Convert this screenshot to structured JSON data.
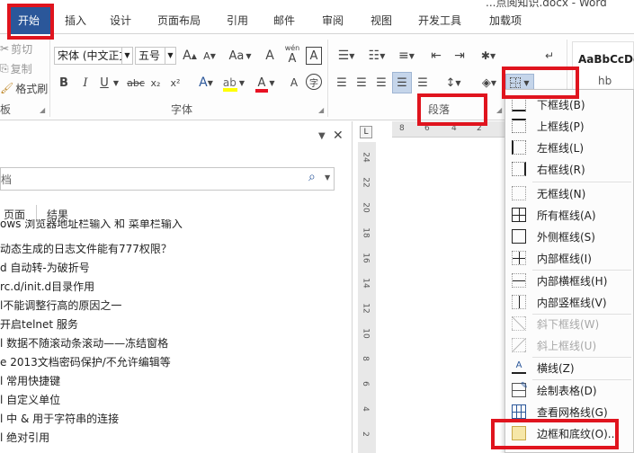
{
  "title": "...点阅知识.docx - Word",
  "tabs": [
    "开始",
    "插入",
    "设计",
    "页面布局",
    "引用",
    "邮件",
    "审阅",
    "视图",
    "开发工具",
    "加载项"
  ],
  "clipboard": {
    "cut": "剪切",
    "copy": "复制",
    "format_painter": "格式刷",
    "group_label": "板"
  },
  "font": {
    "name": "宋体 (中文正文)",
    "size": "五号",
    "grow": "A",
    "shrink": "A",
    "case": "Aa",
    "clear": "A",
    "pinyin_top": "wén",
    "pinyin_char": "A",
    "border_char": "A",
    "bold": "B",
    "italic": "I",
    "underline": "U",
    "strike": "abc",
    "sub": "x₂",
    "sup": "x²",
    "group_label": "字体"
  },
  "paragraph": {
    "group_label": "段落"
  },
  "styles": {
    "sample": "AaBbCcDd",
    "sample_label": "hb"
  },
  "nav": {
    "search_placeholder": "档",
    "tabs": [
      "页面",
      "结果"
    ],
    "items": [
      "ows 浏览器地址栏输入 和 菜单栏输入",
      "动态生成的日志文件能有777权限？",
      "d 自动转-为破折号",
      "rc.d/init.d目录作用",
      "l不能调整行高的原因之一",
      "开启telnet 服务",
      "l 数据不随滚动条滚动——冻结窗格",
      "e 2013文档密码保护/不允许编辑等",
      "l 常用快捷键",
      "l 自定义单位",
      "l 中 & 用于字符串的连接",
      "l 绝对引用"
    ]
  },
  "ruler": {
    "h_ticks": [
      "8",
      "6",
      "4",
      "2"
    ],
    "v_ticks": [
      "24",
      "22",
      "20",
      "18",
      "16",
      "14",
      "12",
      "10",
      "8",
      "6",
      "4",
      "2"
    ]
  },
  "border_menu": {
    "items": [
      {
        "label": "下框线(B)",
        "enabled": true
      },
      {
        "label": "上框线(P)",
        "enabled": true
      },
      {
        "label": "左框线(L)",
        "enabled": true
      },
      {
        "label": "右框线(R)",
        "enabled": true
      },
      {
        "label": "无框线(N)",
        "enabled": true
      },
      {
        "label": "所有框线(A)",
        "enabled": true
      },
      {
        "label": "外侧框线(S)",
        "enabled": true
      },
      {
        "label": "内部框线(I)",
        "enabled": true
      },
      {
        "label": "内部横框线(H)",
        "enabled": true
      },
      {
        "label": "内部竖框线(V)",
        "enabled": true
      },
      {
        "label": "斜下框线(W)",
        "enabled": false
      },
      {
        "label": "斜上框线(U)",
        "enabled": false
      },
      {
        "label": "横线(Z)",
        "enabled": true
      },
      {
        "label": "绘制表格(D)",
        "enabled": true
      },
      {
        "label": "查看网格线(G)",
        "enabled": true
      },
      {
        "label": "边框和底纹(O)...",
        "enabled": true
      }
    ]
  },
  "colors": {
    "accent": "#2b579a",
    "highlight_red": "#e0141e",
    "font_color_bar": "#e81123",
    "highlight_bar": "#ffff00"
  }
}
